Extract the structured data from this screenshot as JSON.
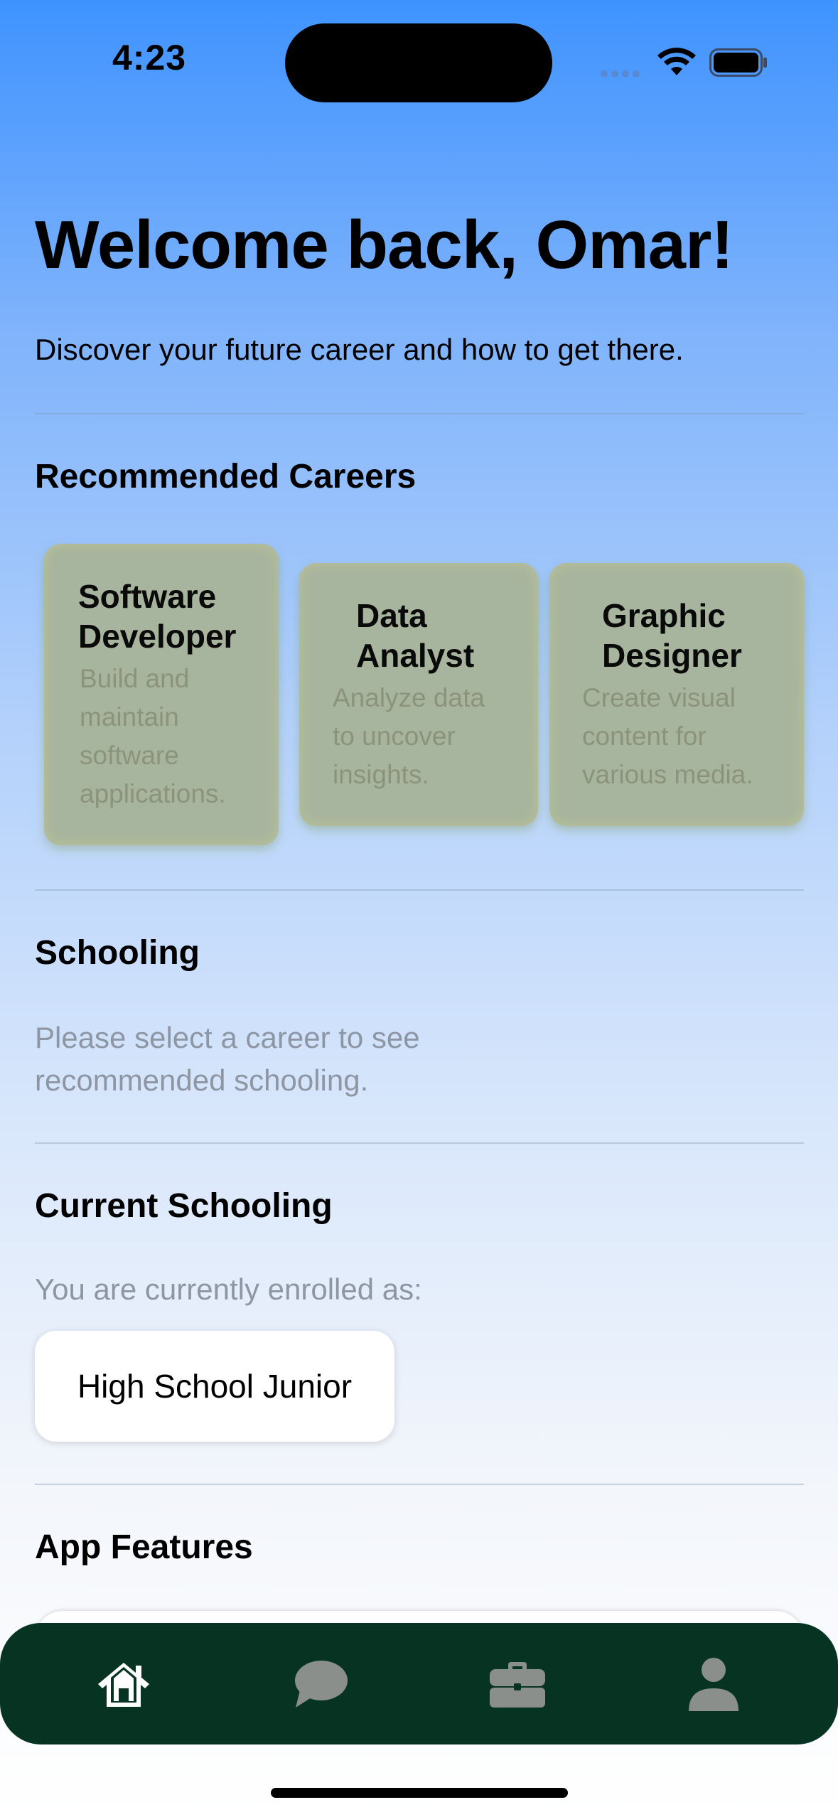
{
  "status_bar": {
    "time": "4:23"
  },
  "header": {
    "title": "Welcome back, Omar!",
    "subtitle": "Discover your future career and how to get there."
  },
  "recommended": {
    "title": "Recommended Careers",
    "careers": [
      {
        "title_line1": "Software",
        "title_line2": "Developer",
        "desc_lines": [
          "Build and",
          "maintain",
          "software",
          "applications."
        ]
      },
      {
        "title_line1": "Data",
        "title_line2": "Analyst",
        "desc_lines": [
          "Analyze data",
          "to uncover",
          "insights."
        ]
      },
      {
        "title_line1": "Graphic",
        "title_line2": "Designer",
        "desc_lines": [
          "Create visual",
          "content for",
          "various media."
        ]
      }
    ]
  },
  "schooling": {
    "title": "Schooling",
    "hint_line1": "Please select a career to see",
    "hint_line2": "recommended schooling."
  },
  "current_schooling": {
    "title": "Current Schooling",
    "label": "You are currently enrolled as:",
    "value": "High School Junior"
  },
  "features": {
    "title": "App Features"
  },
  "tab_bar": {
    "items": [
      {
        "icon": "home-icon",
        "active": true
      },
      {
        "icon": "chat-bubble-icon",
        "active": false
      },
      {
        "icon": "briefcase-icon",
        "active": false
      },
      {
        "icon": "person-icon",
        "active": false
      }
    ],
    "active_color": "#ffffff",
    "inactive_color": "#8a8f8c",
    "background": "#073322"
  }
}
